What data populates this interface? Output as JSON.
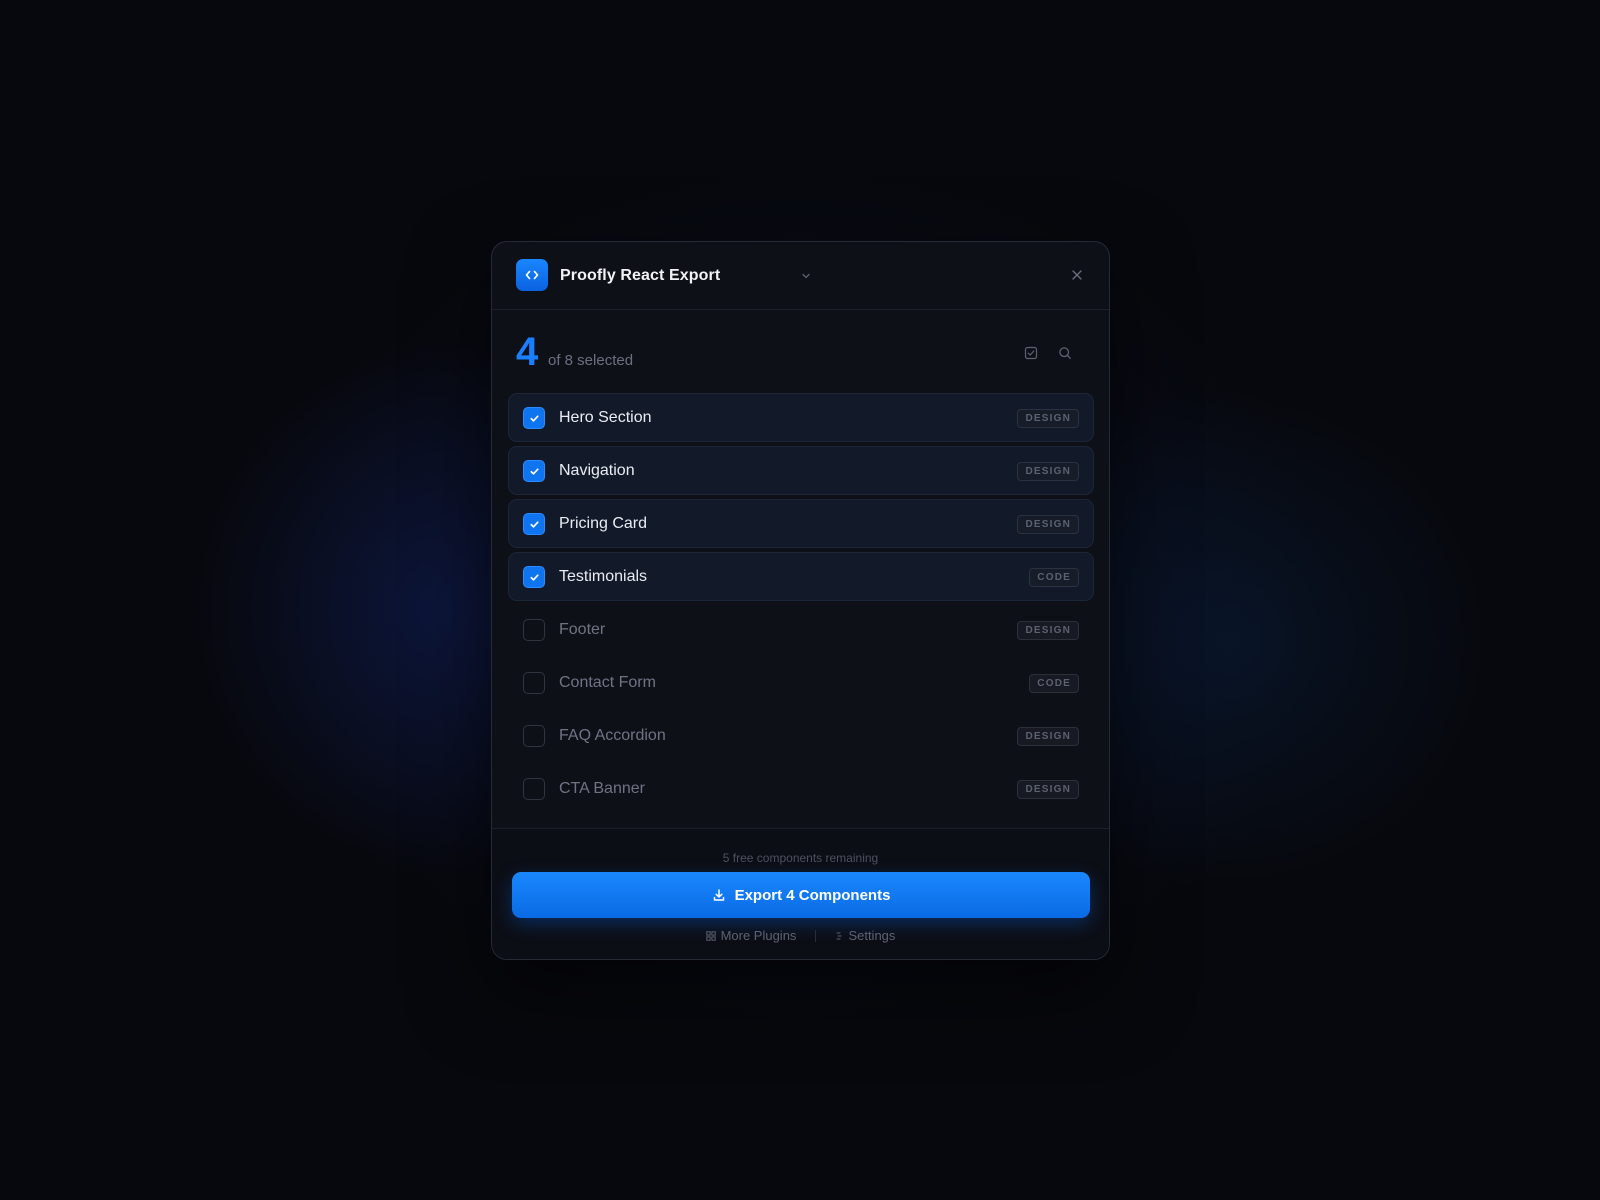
{
  "header": {
    "title": "Proofly React Export",
    "logo_icon": "code-icon",
    "accent": "#1a7fff"
  },
  "selection": {
    "count": "4",
    "of_text": "of 8 selected"
  },
  "components": [
    {
      "name": "Hero Section",
      "tag": "DESIGN",
      "checked": true
    },
    {
      "name": "Navigation",
      "tag": "DESIGN",
      "checked": true
    },
    {
      "name": "Pricing Card",
      "tag": "DESIGN",
      "checked": true
    },
    {
      "name": "Testimonials",
      "tag": "CODE",
      "checked": true
    },
    {
      "name": "Footer",
      "tag": "DESIGN",
      "checked": false
    },
    {
      "name": "Contact Form",
      "tag": "CODE",
      "checked": false
    },
    {
      "name": "FAQ Accordion",
      "tag": "DESIGN",
      "checked": false
    },
    {
      "name": "CTA Banner",
      "tag": "DESIGN",
      "checked": false
    }
  ],
  "footer": {
    "remaining": "5 free components remaining",
    "export_label": "Export 4 Components",
    "more_plugins": "More Plugins",
    "settings": "Settings"
  }
}
